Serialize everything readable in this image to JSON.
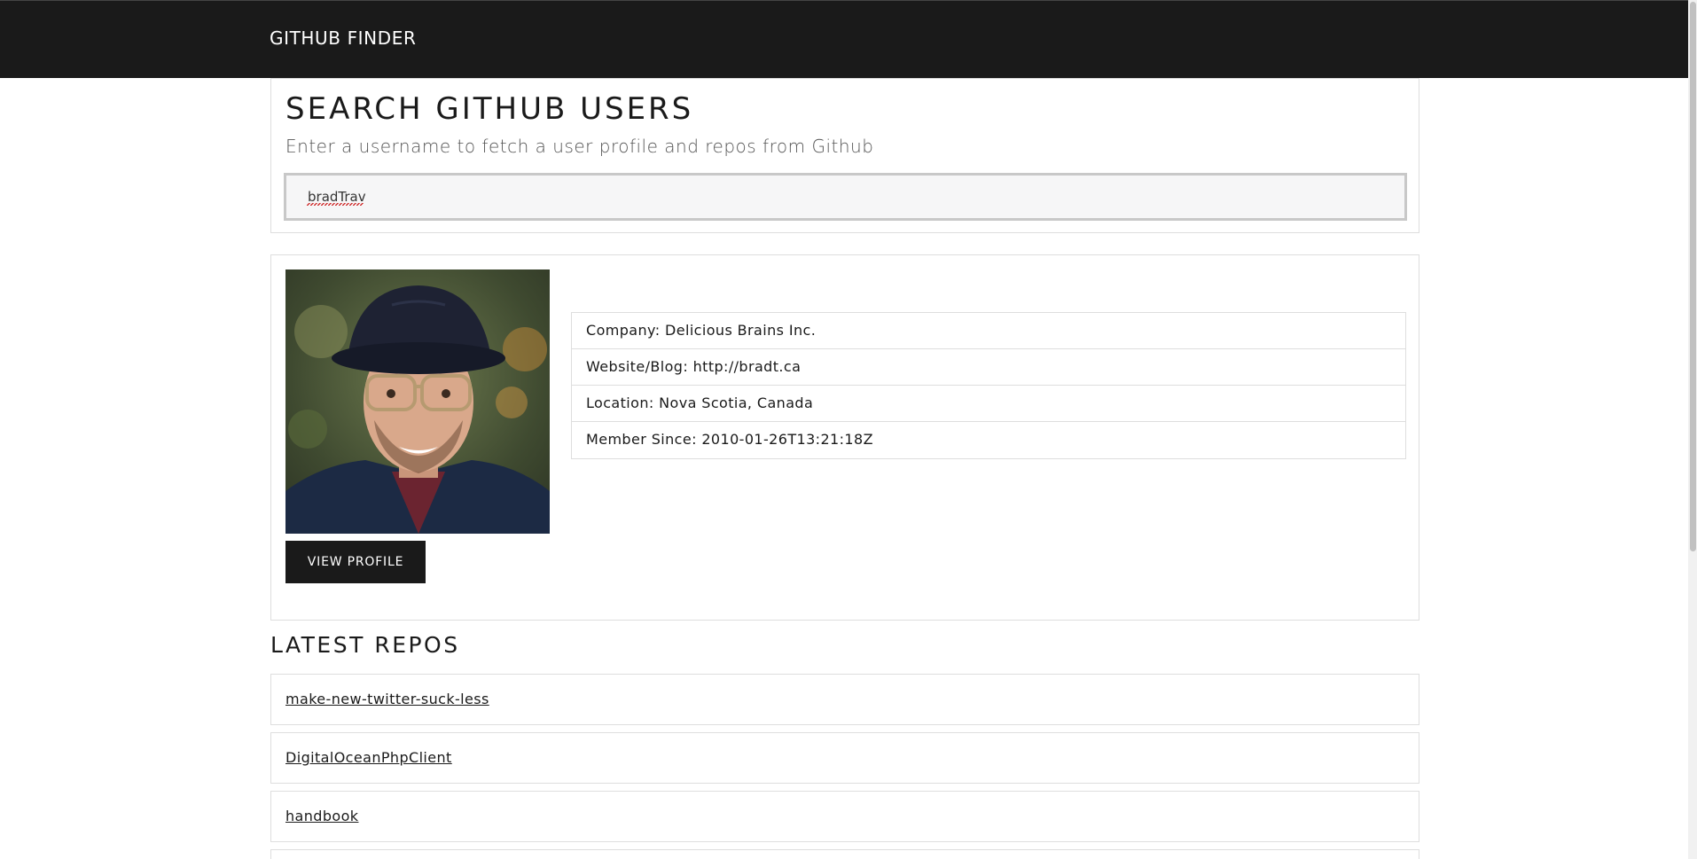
{
  "navbar": {
    "brand": "GITHUB FINDER"
  },
  "search": {
    "title": "SEARCH GITHUB USERS",
    "lead": "Enter a username to fetch a user profile and repos from Github",
    "value": "bradTrav"
  },
  "profile": {
    "avatar_icon": "user-avatar-photo",
    "view_profile_label": "VIEW PROFILE",
    "details": [
      "Company: Delicious Brains Inc.",
      "Website/Blog: http://bradt.ca",
      "Location: Nova Scotia, Canada",
      "Member Since: 2010-01-26T13:21:18Z"
    ]
  },
  "repos": {
    "heading": "LATEST REPOS",
    "items": [
      "make-new-twitter-suck-less",
      "DigitalOceanPhpClient",
      "handbook"
    ]
  },
  "colors": {
    "navbar_bg": "#1a1a1a",
    "button_bg": "#1a1a1a",
    "border": "#dedede"
  }
}
